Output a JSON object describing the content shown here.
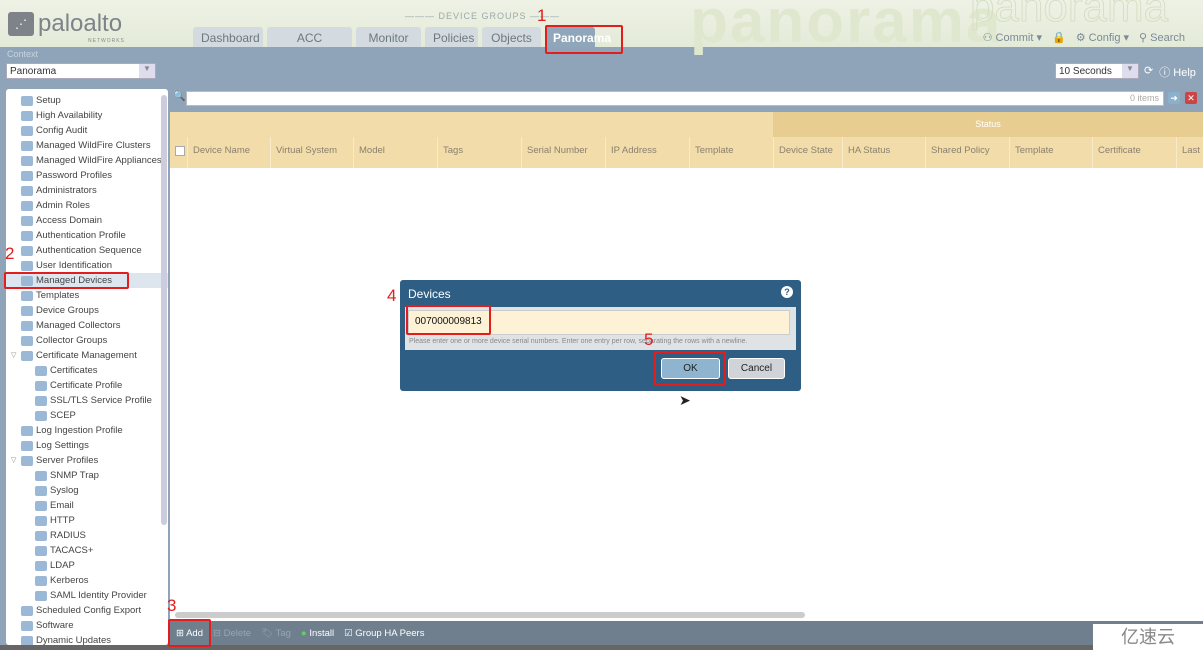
{
  "header": {
    "logo": "paloalto",
    "logo_sub": "NETWORKS",
    "watermark": "panorama",
    "device_groups_label": "DEVICE GROUPS",
    "tabs": [
      {
        "label": "Dashboard"
      },
      {
        "label": "ACC"
      },
      {
        "label": "Monitor"
      },
      {
        "label": "Policies"
      },
      {
        "label": "Objects"
      },
      {
        "label": "Panorama",
        "active": true
      }
    ],
    "commit": "Commit ▾",
    "config": "Config ▾",
    "search": "Search"
  },
  "context": {
    "label": "Context",
    "value": "Panorama"
  },
  "refresh": {
    "value": "10 Seconds",
    "help": "Help"
  },
  "sidebar": {
    "items": [
      {
        "label": "Setup",
        "level": 0
      },
      {
        "label": "High Availability",
        "level": 0
      },
      {
        "label": "Config Audit",
        "level": 0
      },
      {
        "label": "Managed WildFire Clusters",
        "level": 0
      },
      {
        "label": "Managed WildFire Appliances",
        "level": 0
      },
      {
        "label": "Password Profiles",
        "level": 0
      },
      {
        "label": "Administrators",
        "level": 0
      },
      {
        "label": "Admin Roles",
        "level": 0
      },
      {
        "label": "Access Domain",
        "level": 0
      },
      {
        "label": "Authentication Profile",
        "level": 0
      },
      {
        "label": "Authentication Sequence",
        "level": 0
      },
      {
        "label": "User Identification",
        "level": 0
      },
      {
        "label": "Managed Devices",
        "level": 0,
        "selected": true
      },
      {
        "label": "Templates",
        "level": 0
      },
      {
        "label": "Device Groups",
        "level": 0
      },
      {
        "label": "Managed Collectors",
        "level": 0
      },
      {
        "label": "Collector Groups",
        "level": 0
      },
      {
        "label": "Certificate Management",
        "level": 0,
        "expanded": true
      },
      {
        "label": "Certificates",
        "level": 1
      },
      {
        "label": "Certificate Profile",
        "level": 1
      },
      {
        "label": "SSL/TLS Service Profile",
        "level": 1
      },
      {
        "label": "SCEP",
        "level": 1
      },
      {
        "label": "Log Ingestion Profile",
        "level": 0
      },
      {
        "label": "Log Settings",
        "level": 0
      },
      {
        "label": "Server Profiles",
        "level": 0,
        "expanded": true
      },
      {
        "label": "SNMP Trap",
        "level": 1
      },
      {
        "label": "Syslog",
        "level": 1
      },
      {
        "label": "Email",
        "level": 1
      },
      {
        "label": "HTTP",
        "level": 1
      },
      {
        "label": "RADIUS",
        "level": 1
      },
      {
        "label": "TACACS+",
        "level": 1
      },
      {
        "label": "LDAP",
        "level": 1
      },
      {
        "label": "Kerberos",
        "level": 1
      },
      {
        "label": "SAML Identity Provider",
        "level": 1
      },
      {
        "label": "Scheduled Config Export",
        "level": 0
      },
      {
        "label": "Software",
        "level": 0
      },
      {
        "label": "Dynamic Updates",
        "level": 0
      }
    ]
  },
  "search": {
    "count": "0 items"
  },
  "table": {
    "status_group": "Status",
    "columns": [
      "Device Name",
      "Virtual System",
      "Model",
      "Tags",
      "Serial Number",
      "IP Address",
      "Template",
      "Device State",
      "HA Status",
      "Shared Policy",
      "Template",
      "Certificate",
      "Last"
    ]
  },
  "toolbar": {
    "add": "Add",
    "delete": "Delete",
    "tag": "Tag",
    "install": "Install",
    "group_ha": "Group HA Peers"
  },
  "dialog": {
    "title": "Devices",
    "value": "007000009813",
    "hint": "Please enter one or more device serial numbers. Enter one entry per row, separating the rows with a newline.",
    "ok": "OK",
    "cancel": "Cancel"
  },
  "annotations": [
    "1",
    "2",
    "3",
    "4",
    "5"
  ],
  "watermark_logo": "亿速云"
}
